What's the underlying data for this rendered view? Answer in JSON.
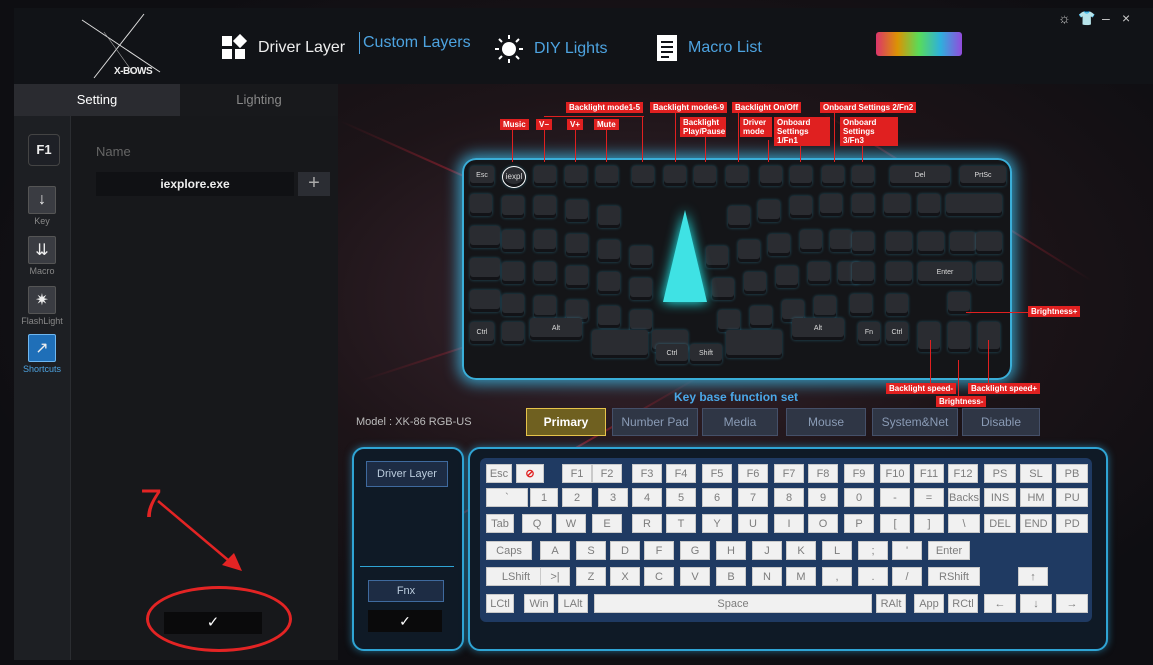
{
  "app": {
    "brand": "X-BOWS"
  },
  "nav": {
    "driver_layer": "Driver Layer",
    "custom_layers": "Custom Layers",
    "diy_lights": "DIY Lights",
    "macro_list": "Macro List"
  },
  "window_controls": {
    "settings": "☼",
    "skin": "👕",
    "minimize": "–",
    "close": "×"
  },
  "left_tabs": {
    "setting": "Setting",
    "lighting": "Lighting"
  },
  "sidebar": {
    "layer_badge": "F1",
    "items": [
      {
        "label": "Key",
        "icon": "arrow-down-icon",
        "glyph": "↓"
      },
      {
        "label": "Macro",
        "icon": "double-arrow-down-icon",
        "glyph": "⇊"
      },
      {
        "label": "FlashLight",
        "icon": "flashlight-icon",
        "glyph": "✷"
      },
      {
        "label": "Shortcuts",
        "icon": "shortcut-arrow-icon",
        "glyph": "↗"
      }
    ]
  },
  "shortcut": {
    "name_label": "Name",
    "name_value": "iexplore.exe",
    "add_glyph": "+"
  },
  "confirm_glyph": "✓",
  "annotation": {
    "number": "7"
  },
  "keyboard_callouts": {
    "music": "Music",
    "vol_down": "V−",
    "vol_up": "V+",
    "mute": "Mute",
    "backlight_mode_1_5": "Backlight mode1-5",
    "backlight_mode_6_9": "Backlight mode6-9",
    "backlight_on_off": "Backlight On/Off",
    "onboard_settings_2": "Onboard Settings 2/Fn2",
    "backlight_play_pause": "Backlight Play/Pause",
    "driver_mode": "Driver mode",
    "onboard_settings_1": "Onboard Settings 1/Fn1",
    "onboard_settings_3": "Onboard Settings 3/Fn3",
    "brightness_up": "Brightness+",
    "backlight_speed_down": "Backlight speed-",
    "backlight_speed_up": "Backlight speed+",
    "brightness_down": "Brightness-"
  },
  "keyboard_keys": {
    "esc": "Esc",
    "iexpl": "iexpl",
    "del": "Del",
    "prtsc": "PrtSc",
    "enter": "Enter",
    "ctrl": "Ctrl",
    "shift": "Shift",
    "alt": "Alt",
    "fn": "Fn"
  },
  "key_function": {
    "title": "Key base function set",
    "model_label": "Model :",
    "model_value": "XK-86 RGB-US",
    "tabs": [
      "Primary",
      "Number Pad",
      "Media",
      "Mouse",
      "System&Net",
      "Disable"
    ]
  },
  "layers": {
    "driver_layer": "Driver Layer",
    "fnx": "Fnx"
  },
  "virtual_keyboard": {
    "rows": [
      [
        "Esc",
        "⊘",
        "F1",
        "F2",
        "F3",
        "F4",
        "F5",
        "F6",
        "F7",
        "F8",
        "F9",
        "F10",
        "F11",
        "F12",
        "PS",
        "SL",
        "PB"
      ],
      [
        "`",
        "1",
        "2",
        "3",
        "4",
        "5",
        "6",
        "7",
        "8",
        "9",
        "0",
        "-",
        "=",
        "Backs",
        "INS",
        "HM",
        "PU"
      ],
      [
        "Tab",
        "Q",
        "W",
        "E",
        "R",
        "T",
        "Y",
        "U",
        "I",
        "O",
        "P",
        "[",
        "]",
        "\\",
        "DEL",
        "END",
        "PD"
      ],
      [
        "Caps",
        "A",
        "S",
        "D",
        "F",
        "G",
        "H",
        "J",
        "K",
        "L",
        ";",
        "'",
        "Enter"
      ],
      [
        "LShift",
        ">|",
        "Z",
        "X",
        "C",
        "V",
        "B",
        "N",
        "M",
        ",",
        ".",
        "/",
        "RShift",
        "↑"
      ],
      [
        "LCtl",
        "Win",
        "LAlt",
        "Space",
        "RAlt",
        "App",
        "RCtl",
        "←",
        "↓",
        "→"
      ]
    ]
  }
}
